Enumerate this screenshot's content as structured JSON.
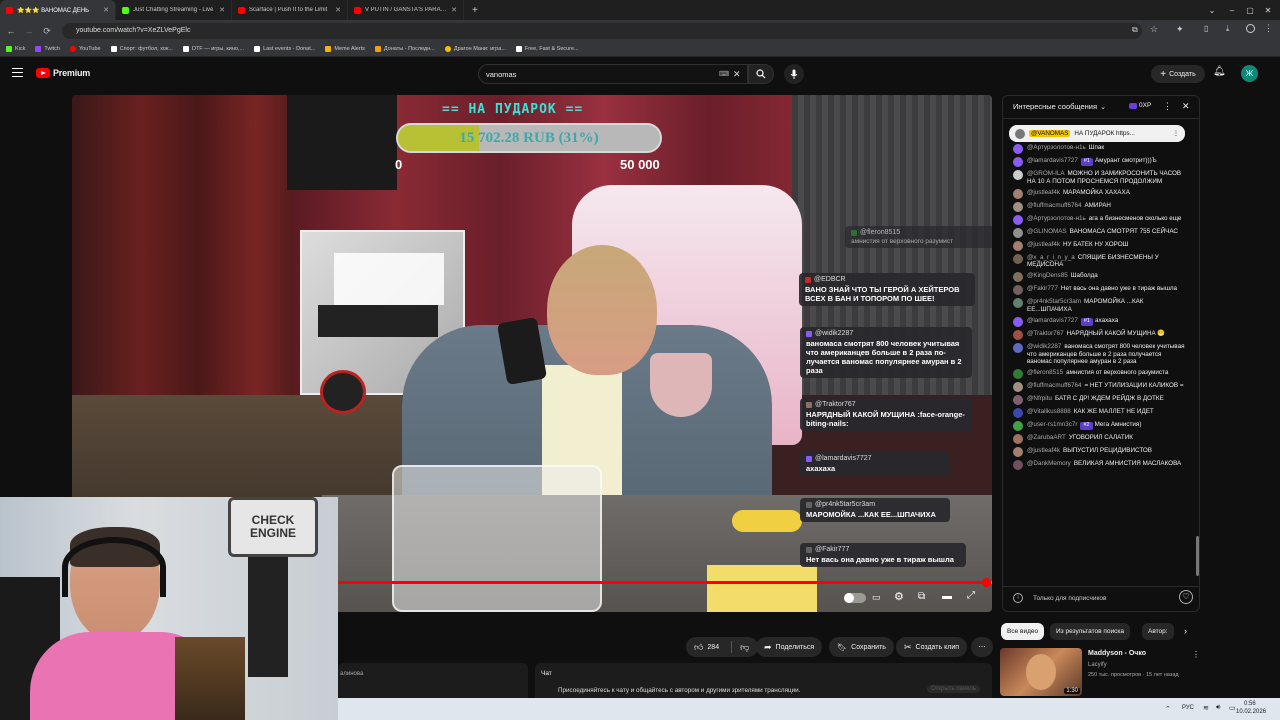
{
  "browser": {
    "tabs": [
      {
        "title": "⭐⭐⭐ ВАНОМАС ДЕНЬ",
        "color": "#ff0000",
        "active": true
      },
      {
        "title": "Just Chatting Streaming - Live",
        "color": "#53fc18"
      },
      {
        "title": "Scarface | Push It to the Limit",
        "color": "#ff0000"
      },
      {
        "title": "V PUTIN / GANSTA'S PARADISE",
        "color": "#ff0000"
      }
    ],
    "new_tab": "+",
    "url": "youtube.com/watch?v=XeZLVePgElc",
    "bookmarks": [
      {
        "label": "Kick",
        "color": "#53fc18"
      },
      {
        "label": "Twitch",
        "color": "#9146ff"
      },
      {
        "label": "YouTube",
        "color": "#ff0000"
      },
      {
        "label": "Спорт: футбол, хок...",
        "color": "#ffffff"
      },
      {
        "label": "DTF — игры, кино,...",
        "color": "#ffffff"
      },
      {
        "label": "Last events - Donat...",
        "color": "#ffffff"
      },
      {
        "label": "Meme Alerts",
        "color": "#f5b400"
      },
      {
        "label": "Донаты - Последн...",
        "color": "#f59e0b"
      },
      {
        "label": "Драгон Мани: игра...",
        "color": "#f5c400"
      },
      {
        "label": "Free, Fast & Secure...",
        "color": "#ffffff"
      }
    ]
  },
  "header": {
    "logo": "Premium",
    "search_value": "vanomas",
    "create_label": "Создать",
    "avatar_letter": "Ж",
    "accent": "#ff0000"
  },
  "video": {
    "goal_title": "== НА ПУДАРОК ==",
    "goal_amount": "15 702.28 RUB (31%)",
    "goal_progress": 0.31,
    "goal_min": "0",
    "goal_max": "50 000",
    "overlay_chat": [
      {
        "user": "@fleron8515",
        "text": "амнистия от верховного разумист"
      },
      {
        "user": "@EDBCR",
        "text": "ВАНО ЗНАЙ ЧТО ТЫ ГЕРОЙ А ХЕЙТЕРОВ ВСЕХ В БАН И ТОПОРОМ ПО ШЕЕ!"
      },
      {
        "user": "@widik2287",
        "text": "ваномаса смотрят 800 человек учитывая что американцев больше в 2 раза по-лучается ваномас популярнее амуран в 2 раза"
      },
      {
        "user": "@Traktor767",
        "text": "НАРЯДНЫЙ КАКОЙ МУЩИНА :face-orange-biting-nails:"
      },
      {
        "user": "@lamardavis7727",
        "text": "ахахаха"
      },
      {
        "user": "@pr4nk5tar5cr3am",
        "text": "МАРОМОЙКА ...КАК ЕЕ...ШПАЧИХА"
      },
      {
        "user": "@Fakir777",
        "text": "Нет вась она давно уже в тираж вышла"
      }
    ],
    "progress": 0.995
  },
  "webcam": {
    "sign_text": "CHECK ENGINE"
  },
  "livechat": {
    "header_label": "Интересные сообщения",
    "points_label": "0XP",
    "pinned_user": "@VANOMAS",
    "pinned_text": "НА ПУДАРОК https...",
    "messages": [
      {
        "user": "@Артурзолотов-н1ь",
        "text": "Шпак",
        "color": "#8a5cf6"
      },
      {
        "user": "@lamardavis7727",
        "badge": "#1",
        "text": "Амурант смотрит)))Ъ",
        "color": "#8a5cf6"
      },
      {
        "user": "@GROM-ILA",
        "text": "МОЖНО И ЗАМИКРОСОНИТЬ ЧАСОВ НА 10 А ПОТОМ ПРОСНЕМСЯ ПРОДОЛЖИМ",
        "color": "#cccccc"
      },
      {
        "user": "@justleaf4k",
        "text": "МАРАМОЙКА ХАХАХА",
        "color": "#a08070"
      },
      {
        "user": "@fluffmacmuff6764",
        "text": "АМИРАН",
        "color": "#a09080"
      },
      {
        "user": "@Артурзолотов-н1ь",
        "text": "ага а бизнесменов сколько еще",
        "color": "#8a5cf6"
      },
      {
        "user": "@GLINOMAS",
        "text": "ВАНОМАСА СМОТРЯТ 755 СЕЙЧАС",
        "color": "#909090"
      },
      {
        "user": "@justleaf4k",
        "text": "НУ БАТЕК НУ ХОРОШ",
        "color": "#a08070"
      },
      {
        "user": "@x_a_r_i_n_y_a",
        "text": "СПЯЩИЕ БИЗНЕСМЕНЫ У МЕДИСОНА",
        "color": "#706050"
      },
      {
        "user": "@KingDens85",
        "text": "Шаболда",
        "color": "#807060"
      },
      {
        "user": "@Fakir777",
        "text": "Нет вась она давно уже в тираж вышла",
        "color": "#706060"
      },
      {
        "user": "@pr4nk5tar5cr3am",
        "text": "МАРОМОЙКА ...КАК ЕЕ...ШПАЧИХА",
        "color": "#608070"
      },
      {
        "user": "@lamardavis7727",
        "badge": "#1",
        "text": "ахахаха",
        "color": "#8a5cf6"
      },
      {
        "user": "@Traktor767",
        "text": "НАРЯДНЫЙ КАКОЙ МУЩИНА 😬",
        "color": "#a05040"
      },
      {
        "user": "@widik2287",
        "text": "ваномаса смотрят 800 человек учитывая что американцев больше в 2 раза получается ваномас популярнее амуран в 2 раза",
        "color": "#5c6bc0"
      },
      {
        "user": "@fleron8515",
        "text": "амнистия от верховного разумиста",
        "color": "#2e7d32"
      },
      {
        "user": "@fluffmacmuff6764",
        "text": "= НЕТ УТИЛИЗАЦИИ КАЛИКОВ =",
        "color": "#a09080"
      },
      {
        "user": "@Nfrpitu",
        "text": "БАТЯ С ДР! ЖДЕМ РЕЙДЖ В ДОТКЕ",
        "color": "#806070"
      },
      {
        "user": "@Vitalikus8888",
        "text": "КАК ЖЕ МАЛЛЕТ НЕ ИДЕТ",
        "color": "#3949ab"
      },
      {
        "user": "@user-rs1mn3c7r",
        "badge": "#2",
        "text": "Мега Амнистия)",
        "color": "#43a047"
      },
      {
        "user": "@ZarubaART",
        "text": "УГОВОРИЛ САЛАТИК",
        "color": "#a07060"
      },
      {
        "user": "@justleaf4k",
        "text": "ВЫПУСТИЛ РЕЦИДИВИСТОВ",
        "color": "#a08070"
      },
      {
        "user": "@DankMemory",
        "text": "ВЕЛИКАЯ АМНИСТИЯ МАСЛАКОВА",
        "color": "#705060"
      }
    ],
    "input_placeholder": "Только для подписчиков"
  },
  "below": {
    "likes": "284",
    "share_label": "Поделиться",
    "save_label": "Сохранить",
    "clip_label": "Создать клип",
    "chat_label": "Чат",
    "chat_prompt": "Присоединяйтесь к чату и общайтесь с автором и другими зрителями трансляции.",
    "chat_open": "Открыть панель",
    "left_snippet": "алинова"
  },
  "recs": {
    "chips": [
      "Все видео",
      "Из результатов поиска",
      "Автор: "
    ],
    "video_title": "Maddyson - Очко",
    "channel": "Lacyify",
    "meta": "250 тыс. просмотров · 15 лет назад",
    "duration": "1:30"
  },
  "taskbar": {
    "lang": "РУС",
    "time": "0:56",
    "date": "10.02.2026"
  }
}
